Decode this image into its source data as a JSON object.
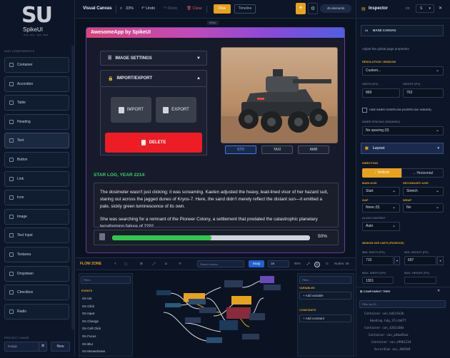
{
  "app": {
    "name": "SpikeUI",
    "tagline": "Drag · Drop · Style · Build"
  },
  "sidebar": {
    "section": "ADD COMPONENTS",
    "items": [
      "Container",
      "Accordion",
      "Table",
      "Heading",
      "Text",
      "Button",
      "Link",
      "Icon",
      "Image",
      "Text Input",
      "Textarea",
      "Dropdown",
      "Checkbox",
      "Radio"
    ],
    "project_label": "PROJECT NAME",
    "project_value": "bedpjx",
    "clear_label": "✕",
    "new_label": "New"
  },
  "toolbar": {
    "title": "Visual Canvas",
    "zoom": "33%",
    "undo": "Undo",
    "redo": "Redo",
    "clear": "Clear",
    "flow": "Flow",
    "timeline": "Timeline",
    "elements": "45 elements"
  },
  "canvas": {
    "tag": "500px",
    "app_title": "AwesomeApp by SpikeUI",
    "accordions": {
      "image_settings": "IMAGE SETTINGS",
      "import_export": "IMPORT/EXPORT"
    },
    "import": "IMPORT",
    "export": "EXPORT",
    "delete": "DELETE",
    "chips": [
      "STD",
      "TAXI",
      "AMB"
    ],
    "star_log_title": "STAR LOG, YEAR 2214:",
    "paragraph1": "The dosimeter wasn't just clicking; it was screaming. Kaelen adjusted the heavy, lead-lined visor of her hazard suit, staring out across the jagged dunes of Kryos-7. Here, the sand didn't merely reflect the distant sun—it emitted a pale, sickly green luminescence of its own.",
    "paragraph2": "She was searching for a remnant of the Pioneer Colony, a settlement that predated the catastrophic planetary terraforming failure of 2201.",
    "progress": 50,
    "progress_label": "50%"
  },
  "flow": {
    "title": "FLOW ZONE",
    "search_placeholder": "Search nodes...",
    "snap": "Snap",
    "grid": "16",
    "zoom": "90%",
    "nodes": "Nodes: 45",
    "filter_placeholder": "Filter...",
    "events_label": "EVENTS",
    "events": [
      "On Init",
      "On Click",
      "On Input",
      "On Change",
      "On Cell Click",
      "On Focus",
      "On Blur",
      "On MouseDown"
    ],
    "vars_filter": "Filter...",
    "variables_label": "VARIABLES",
    "add_variable": "+ Add variable",
    "constants_label": "CONSTANTS",
    "add_constant": "+ Add constant"
  },
  "inspector": {
    "title": "Inspector",
    "breakpoint": "S",
    "base_canvas": "BASE CANVAS",
    "base_hint": "Adjust the global page properties",
    "resolution_label": "RESOLUTION / WINDOW",
    "resolution_value": "Custom...",
    "width_label": "WIDTH (PX)",
    "width_value": "869",
    "height_label": "HEIGHT (PX)",
    "height_value": "763",
    "hide_overflow": "HIDE INNER OVERFLOW (OVERFLOW: HIDDEN)",
    "inner_spacing_label": "INNER SPACING (PADDING)",
    "inner_spacing_value": "No spacing (0)",
    "layout": "Layout",
    "direction_label": "DIRECTION",
    "vertical": "Vertical",
    "horizontal": "Horizontal",
    "main_axis_label": "MAIN AXIS",
    "main_axis_value": "Start",
    "secondary_axis_label": "SECONDARY AXIS",
    "secondary_axis_value": "Stretch",
    "gap_label": "GAP",
    "gap_value": "None (0)",
    "wrap_label": "WRAP",
    "wrap_value": "No",
    "align_label": "ALIGN CONTENT",
    "align_value": "Auto",
    "window_limits_label": "WINDOW SIZE LIMITS (PX/DEVICE)",
    "min_width_label": "MIN. WIDTH (PX)",
    "min_width_value": "710",
    "min_height_label": "MIN. HEIGHT (PX)",
    "min_height_value": "697",
    "max_width_label": "MAX. WIDTH (PX)",
    "max_height_label": "MAX. HEIGHT (PX)",
    "max_width_value": "1301",
    "tree_title": "COMPONENT TREE",
    "tree_filter": "Filter by ID...",
    "tree": [
      "Container con_bd1c5e2b",
      "Heading hdg_37ccb67f",
      "Container con_4261c68e",
      "Container con_pdkw4twe",
      "Container con_e99b1234",
      "Accordion acc_4b81b9"
    ]
  }
}
